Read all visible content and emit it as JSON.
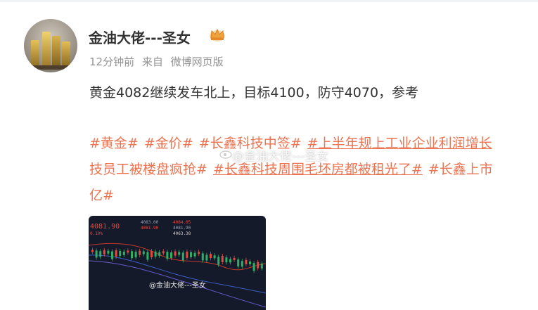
{
  "post": {
    "username": "金油大佬---圣女",
    "time": "12分钟前",
    "source_prefix": "来自",
    "source": "微博网页版",
    "text": "黄金4082继续发车北上，目标4100，防守4070，参考",
    "topics_line1": [
      "#黄金#",
      "#金价#",
      "#长鑫科技中签#",
      "#上半年规上工业企业利润增长"
    ],
    "topics_line2": [
      "技员工被楼盘疯抢#",
      "#长鑫科技周围毛坯房都被租光了#",
      "#长鑫上市"
    ],
    "topics_line3": [
      "亿#"
    ],
    "watermark": "@金油大佬---圣女"
  },
  "chart": {
    "header_price": "4081.90",
    "header_pct": "0.10%",
    "fields": [
      "4083.00",
      "4084.05",
      "4081.90",
      "4081.90",
      "4063.38"
    ],
    "watermark": "@金油大佬---圣女"
  },
  "colors": {
    "topic": "#eb7350",
    "up": "#e04a3f",
    "down": "#2fae66",
    "bg": "#151a2b"
  }
}
